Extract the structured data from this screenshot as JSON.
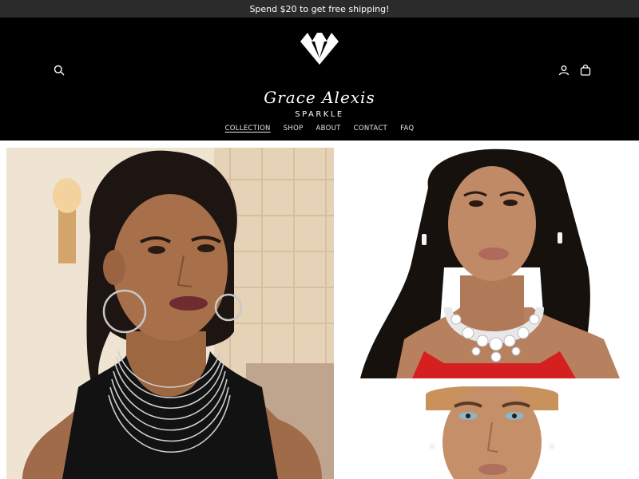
{
  "announcement": {
    "text": "Spend $20 to get free shipping!"
  },
  "header": {
    "brand_name": "Grace Alexis",
    "brand_tagline": "SPARKLE",
    "icons": {
      "search": "search-icon",
      "account": "user-icon",
      "cart": "bag-icon",
      "logo": "diamond-icon"
    }
  },
  "nav": {
    "items": [
      {
        "label": "COLLECTION",
        "active": true
      },
      {
        "label": "SHOP",
        "active": false
      },
      {
        "label": "ABOUT",
        "active": false
      },
      {
        "label": "CONTACT",
        "active": false
      },
      {
        "label": "FAQ",
        "active": false
      }
    ]
  },
  "colors": {
    "announcement_bg": "#2b2b2b",
    "header_bg": "#000000",
    "text_light": "#ffffff",
    "dress_red": "#d62020"
  }
}
